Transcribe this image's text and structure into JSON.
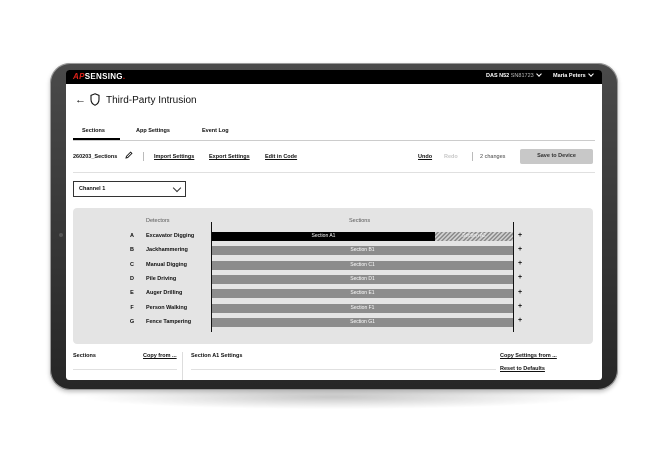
{
  "app": {
    "logo_prefix": "AP",
    "logo_main": "SENSING",
    "logo_suffix": ".",
    "device_model": "DAS N52",
    "device_serial": "SN81723",
    "user_name": "Maria Peters"
  },
  "page": {
    "back_glyph": "←",
    "title": "Third-Party Intrusion"
  },
  "tabs": [
    {
      "label": "Sections",
      "active": true
    },
    {
      "label": "App Settings",
      "active": false
    },
    {
      "label": "Event Log",
      "active": false
    }
  ],
  "toolbar": {
    "config_name": "260203_Sections",
    "import_label": "Import Settings",
    "export_label": "Export Settings",
    "edit_code_label": "Edit in Code",
    "undo_label": "Undo",
    "redo_label": "Redo",
    "changes_label": "2 changes",
    "save_label": "Save to Device"
  },
  "channel_select": {
    "value": "Channel 1"
  },
  "panel": {
    "detectors_header": "Detectors",
    "sections_header": "Sections",
    "rows": [
      {
        "letter": "A",
        "name": "Excavator Digging",
        "sections": [
          {
            "label": "Section A1",
            "style": "selected",
            "fraction": 0.74
          },
          {
            "label": "Section A2",
            "style": "hatched",
            "fraction": 0.26
          }
        ]
      },
      {
        "letter": "B",
        "name": "Jackhammering",
        "sections": [
          {
            "label": "Section B1",
            "style": "normal",
            "fraction": 1
          }
        ]
      },
      {
        "letter": "C",
        "name": "Manual Digging",
        "sections": [
          {
            "label": "Section C1",
            "style": "normal",
            "fraction": 1
          }
        ]
      },
      {
        "letter": "D",
        "name": "Pile Driving",
        "sections": [
          {
            "label": "Section D1",
            "style": "normal",
            "fraction": 1
          }
        ]
      },
      {
        "letter": "E",
        "name": "Auger Drilling",
        "sections": [
          {
            "label": "Section E1",
            "style": "normal",
            "fraction": 1
          }
        ]
      },
      {
        "letter": "F",
        "name": "Person Walking",
        "sections": [
          {
            "label": "Section F1",
            "style": "normal",
            "fraction": 1
          }
        ]
      },
      {
        "letter": "G",
        "name": "Fence Tampering",
        "sections": [
          {
            "label": "Section G1",
            "style": "normal",
            "fraction": 1
          }
        ]
      }
    ],
    "add_glyph": "+"
  },
  "bottom": {
    "sections_label": "Sections",
    "copy_from_label": "Copy from ...",
    "settings_title": "Section A1 Settings",
    "copy_settings_label": "Copy Settings from ...",
    "reset_label": "Reset to Defaults"
  },
  "colors": {
    "brand_red": "#e2231a",
    "topbar": "#000000",
    "section_grey": "#8c8c8c",
    "section_selected": "#000000",
    "panel_bg": "#e4e4e4"
  }
}
